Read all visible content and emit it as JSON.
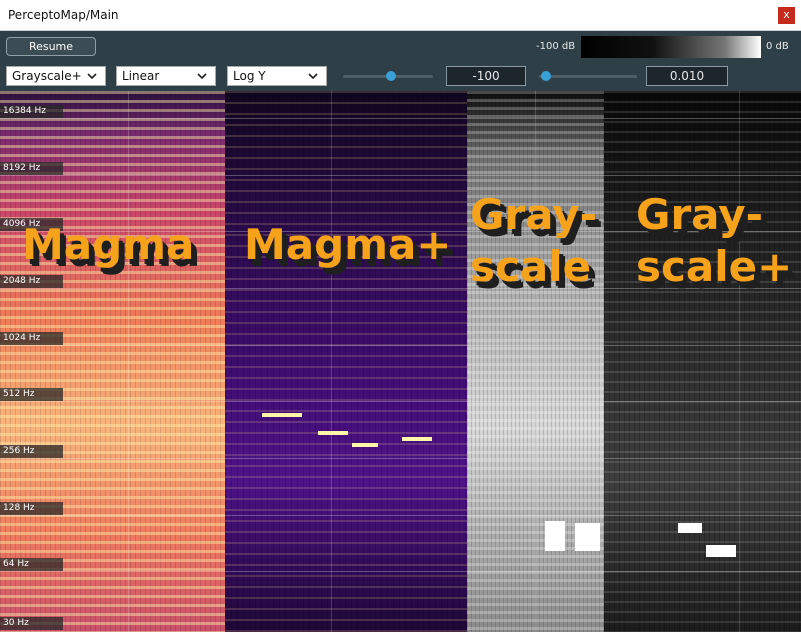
{
  "window": {
    "title": "PerceptoMap/Main",
    "close_label": "x"
  },
  "toolbar": {
    "resume_label": "Resume",
    "db_min_label": "-100 dB",
    "db_max_label": "0 dB",
    "colormap_select": "Grayscale+",
    "scale_select": "Linear",
    "axis_select": "Log Y",
    "slider1_value": "-100",
    "slider2_value": "0.010"
  },
  "spectrogram": {
    "freq_labels": [
      "16384 Hz",
      "8192 Hz",
      "4096 Hz",
      "2048 Hz",
      "1024 Hz",
      "512 Hz",
      "256 Hz",
      "128 Hz",
      "64 Hz",
      "30 Hz"
    ],
    "panel_labels": {
      "magma": "Magma",
      "magma_plus": "Magma+",
      "grayscale_line1": "Gray-",
      "grayscale_line2": "scale",
      "grayscale_plus_line1": "Gray-",
      "grayscale_plus_line2": "scale+"
    }
  },
  "colors": {
    "accent_orange": "#f7a21b",
    "toolbar_bg": "#2e3f47",
    "slider_knob": "#3aa0d8"
  }
}
